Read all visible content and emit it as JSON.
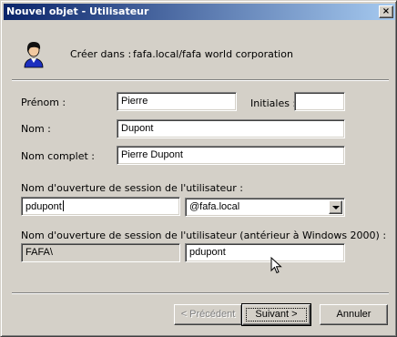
{
  "window": {
    "title": "Nouvel objet - Utilisateur",
    "close_glyph": "×"
  },
  "header": {
    "avatar_icon": "user-icon",
    "create_in_label": "Créer dans :",
    "create_in_value": "fafa.local/fafa world corporation"
  },
  "form": {
    "first_name_label": "Prénom :",
    "first_name_value": "Pierre",
    "initials_label": "Initiales :",
    "initials_value": "",
    "last_name_label": "Nom :",
    "last_name_value": "Dupont",
    "full_name_label": "Nom complet :",
    "full_name_value": "Pierre Dupont",
    "logon_label": "Nom d'ouverture de session de l'utilisateur :",
    "logon_value": "pdupont",
    "domain_selected": "@fafa.local",
    "pre2000_label": "Nom d'ouverture de session de l'utilisateur (antérieur à Windows 2000) :",
    "pre2000_domain": "FAFA\\",
    "pre2000_value": "pdupont"
  },
  "buttons": {
    "back_label": "< Précédent",
    "next_label": "Suivant >",
    "cancel_label": "Annuler"
  }
}
